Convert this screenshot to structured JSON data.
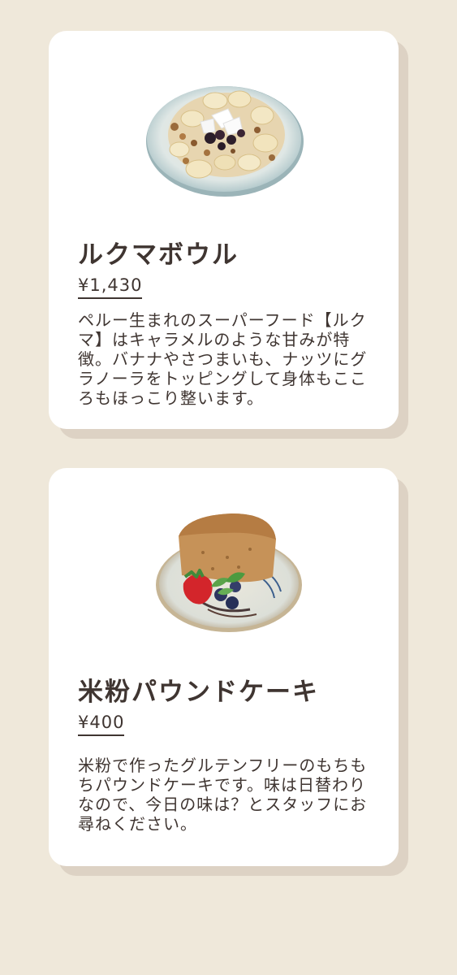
{
  "menu": {
    "items": [
      {
        "image_alt": "ルクマボウル",
        "name": "ルクマボウル",
        "price": "¥1,430",
        "description": "ペルー生まれのスーパーフード【ルクマ】はキャラメルのような甘みが特徴。バナナやさつまいも、ナッツにグラノーラをトッピングして身体もこころもほっこり整います。"
      },
      {
        "image_alt": "米粉パウンドケーキ",
        "name": "米粉パウンドケーキ",
        "price": "¥400",
        "description": "米粉で作ったグルテンフリーのもちもちパウンドケーキです。味は日替わりなので、今日の味は？とスタッフにお尋ねください。"
      }
    ]
  }
}
